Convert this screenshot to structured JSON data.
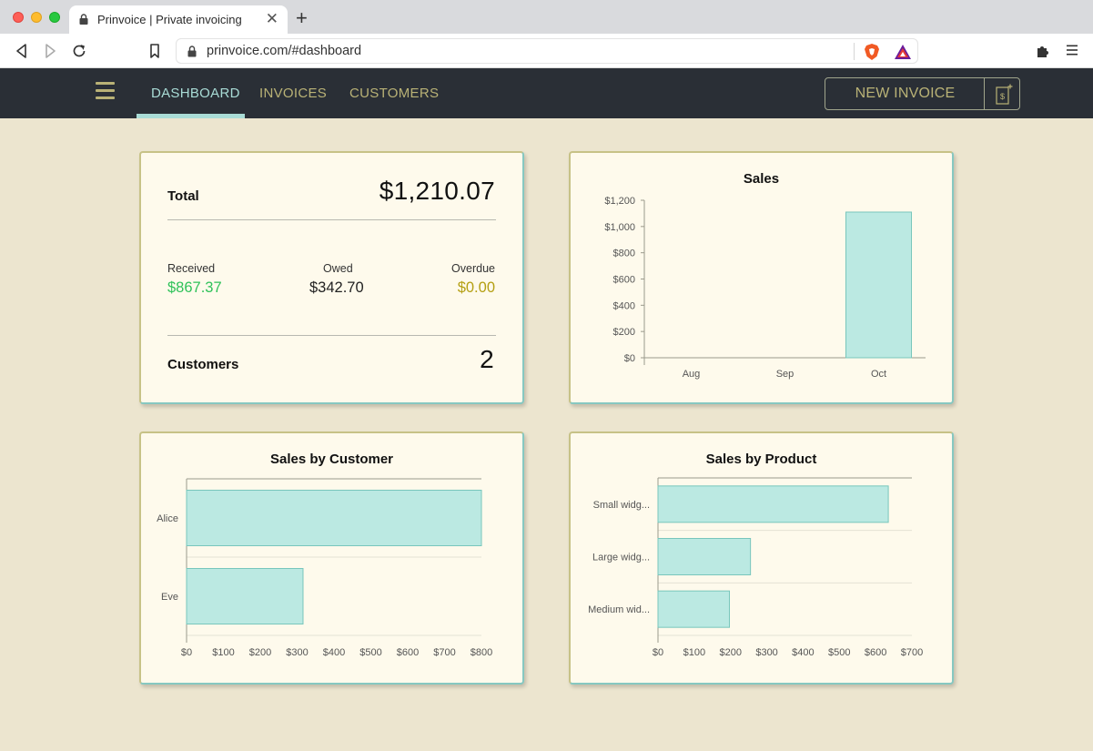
{
  "browser": {
    "tab_title": "Prinvoice | Private invoicing",
    "url": "prinvoice.com/#dashboard",
    "icons": [
      "back-icon",
      "forward-icon",
      "reload-icon",
      "bookmark-icon",
      "lock-icon",
      "brave-shield-icon",
      "brave-rewards-icon",
      "extensions-icon",
      "menu-icon"
    ]
  },
  "nav": {
    "items": [
      {
        "label": "DASHBOARD",
        "active": true
      },
      {
        "label": "INVOICES",
        "active": false
      },
      {
        "label": "CUSTOMERS",
        "active": false
      }
    ],
    "new_invoice_label": "NEW INVOICE"
  },
  "summary": {
    "total_label": "Total",
    "total_value": "$1,210.07",
    "received_label": "Received",
    "received_value": "$867.37",
    "owed_label": "Owed",
    "owed_value": "$342.70",
    "overdue_label": "Overdue",
    "overdue_value": "$0.00",
    "customers_label": "Customers",
    "customers_value": "2"
  },
  "colors": {
    "accent": "#a9dcd6",
    "olive": "#b9b276",
    "received": "#2fc25a",
    "overdue": "#b49f12",
    "bar_fill": "#bbe9e2",
    "bar_stroke": "#78c6bc",
    "nav_bg": "#2a2f36",
    "page_bg": "#ece5cf",
    "card_bg": "#fefaec"
  },
  "chart_data": [
    {
      "type": "bar",
      "title": "Sales",
      "categories": [
        "Aug",
        "Sep",
        "Oct"
      ],
      "values": [
        0,
        0,
        1110
      ],
      "ylim": [
        0,
        1200
      ],
      "yticks": [
        "$0",
        "$200",
        "$400",
        "$600",
        "$800",
        "$1,000",
        "$1,200"
      ],
      "grid": false
    },
    {
      "type": "bar",
      "orientation": "horizontal",
      "title": "Sales by Customer",
      "categories": [
        "Alice",
        "Eve"
      ],
      "values": [
        800,
        316
      ],
      "xlim": [
        0,
        800
      ],
      "xticks": [
        "$0",
        "$100",
        "$200",
        "$300",
        "$400",
        "$500",
        "$600",
        "$700",
        "$800"
      ],
      "grid": true
    },
    {
      "type": "bar",
      "orientation": "horizontal",
      "title": "Sales by Product",
      "categories": [
        "Small widg...",
        "Large widg...",
        "Medium wid..."
      ],
      "values": [
        635,
        255,
        197
      ],
      "xlim": [
        0,
        700
      ],
      "xticks": [
        "$0",
        "$100",
        "$200",
        "$300",
        "$400",
        "$500",
        "$600",
        "$700"
      ],
      "grid": true
    }
  ]
}
